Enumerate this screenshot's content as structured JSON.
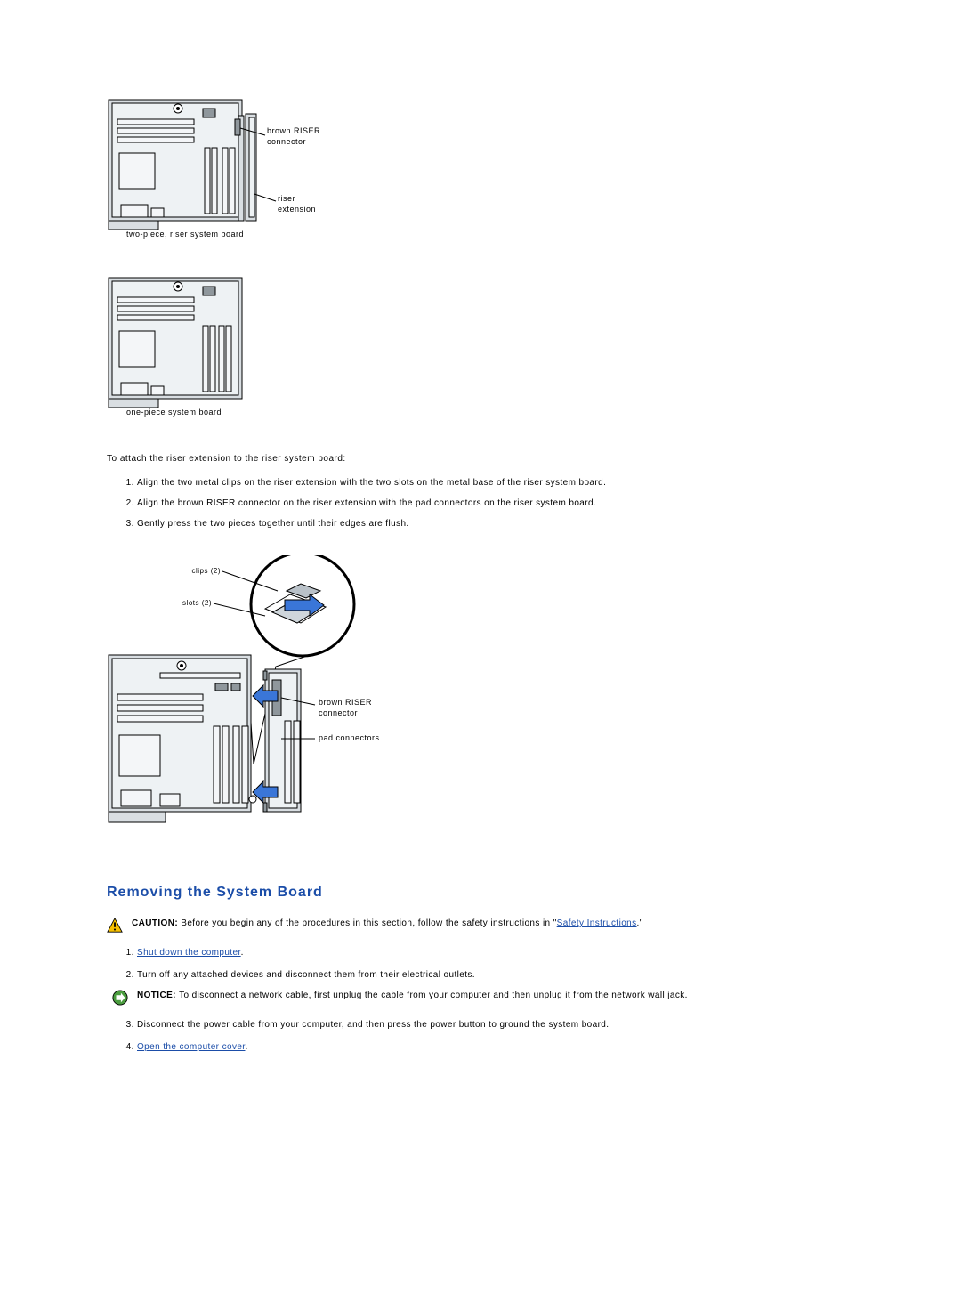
{
  "diagram1": {
    "label_brown_riser_l1": "brown RISER",
    "label_brown_riser_l2": "connector",
    "label_riser_ext_l1": "riser",
    "label_riser_ext_l2": "extension",
    "caption": "two-piece, riser system board"
  },
  "diagram2": {
    "caption": "one-piece system board"
  },
  "attach_intro": "To attach the riser extension to the riser system board:",
  "attach_steps": {
    "s1": "Align the two metal clips on the riser extension with the two slots on the metal base of the riser system board.",
    "s2": "Align the brown RISER connector on the riser extension with the pad connectors on the riser system board.",
    "s3": "Gently press the two pieces together until their edges are flush."
  },
  "diagram3": {
    "label_clips": "clips (2)",
    "label_slots": "slots (2)",
    "label_brown_riser_l1": "brown RISER",
    "label_brown_riser_l2": "connector",
    "label_pad_connectors": "pad connectors"
  },
  "section_title": "Removing the System Board",
  "caution": {
    "prefix": "CAUTION: ",
    "text_before_link": "Before you begin any of the procedures in this section, follow the safety instructions in \"",
    "link_text": "Safety Instructions",
    "text_after_link": ".\""
  },
  "remove_steps": {
    "s1_link": "Shut down the computer",
    "s1_suffix": ".",
    "s2": "Turn off any attached devices and disconnect them from their electrical outlets.",
    "s3": "Disconnect the power cable from your computer, and then press the power button to ground the system board.",
    "s4_link": "Open the computer cover",
    "s4_suffix": "."
  },
  "notice": {
    "prefix": "NOTICE: ",
    "text": "To disconnect a network cable, first unplug the cable from your computer and then unplug it from the network wall jack."
  }
}
